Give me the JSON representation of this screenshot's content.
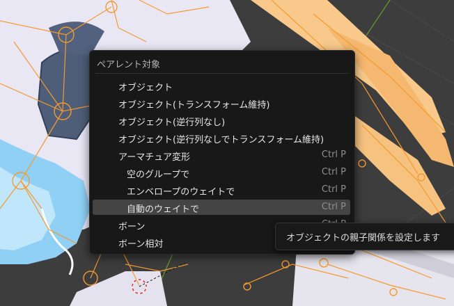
{
  "menu": {
    "title": "ペアレント対象",
    "items": [
      {
        "label": "オブジェクト",
        "shortcut": ""
      },
      {
        "label": "オブジェクト(トランスフォーム維持)",
        "shortcut": ""
      },
      {
        "label": "オブジェクト(逆行列なし)",
        "shortcut": ""
      },
      {
        "label": "オブジェクト(逆行列なしでトランスフォーム維持)",
        "shortcut": ""
      },
      {
        "label": "アーマチュア変形",
        "shortcut": "Ctrl P"
      },
      {
        "label": "空のグループで",
        "shortcut": "Ctrl P"
      },
      {
        "label": "エンベロープのウェイトで",
        "shortcut": "Ctrl P"
      },
      {
        "label": "自動のウェイトで",
        "shortcut": "Ctrl P"
      },
      {
        "label": "ボーン",
        "shortcut": "Ctrl P"
      },
      {
        "label": "ボーン相対",
        "shortcut": ""
      }
    ]
  },
  "tooltip": {
    "text": "オブジェクトの親子関係を設定します"
  },
  "colors": {
    "bone": "#f59a2f",
    "hair": "#f8c98a",
    "skirt_blue": "#7ec8f2",
    "dress_dark": "#4e5d78"
  }
}
